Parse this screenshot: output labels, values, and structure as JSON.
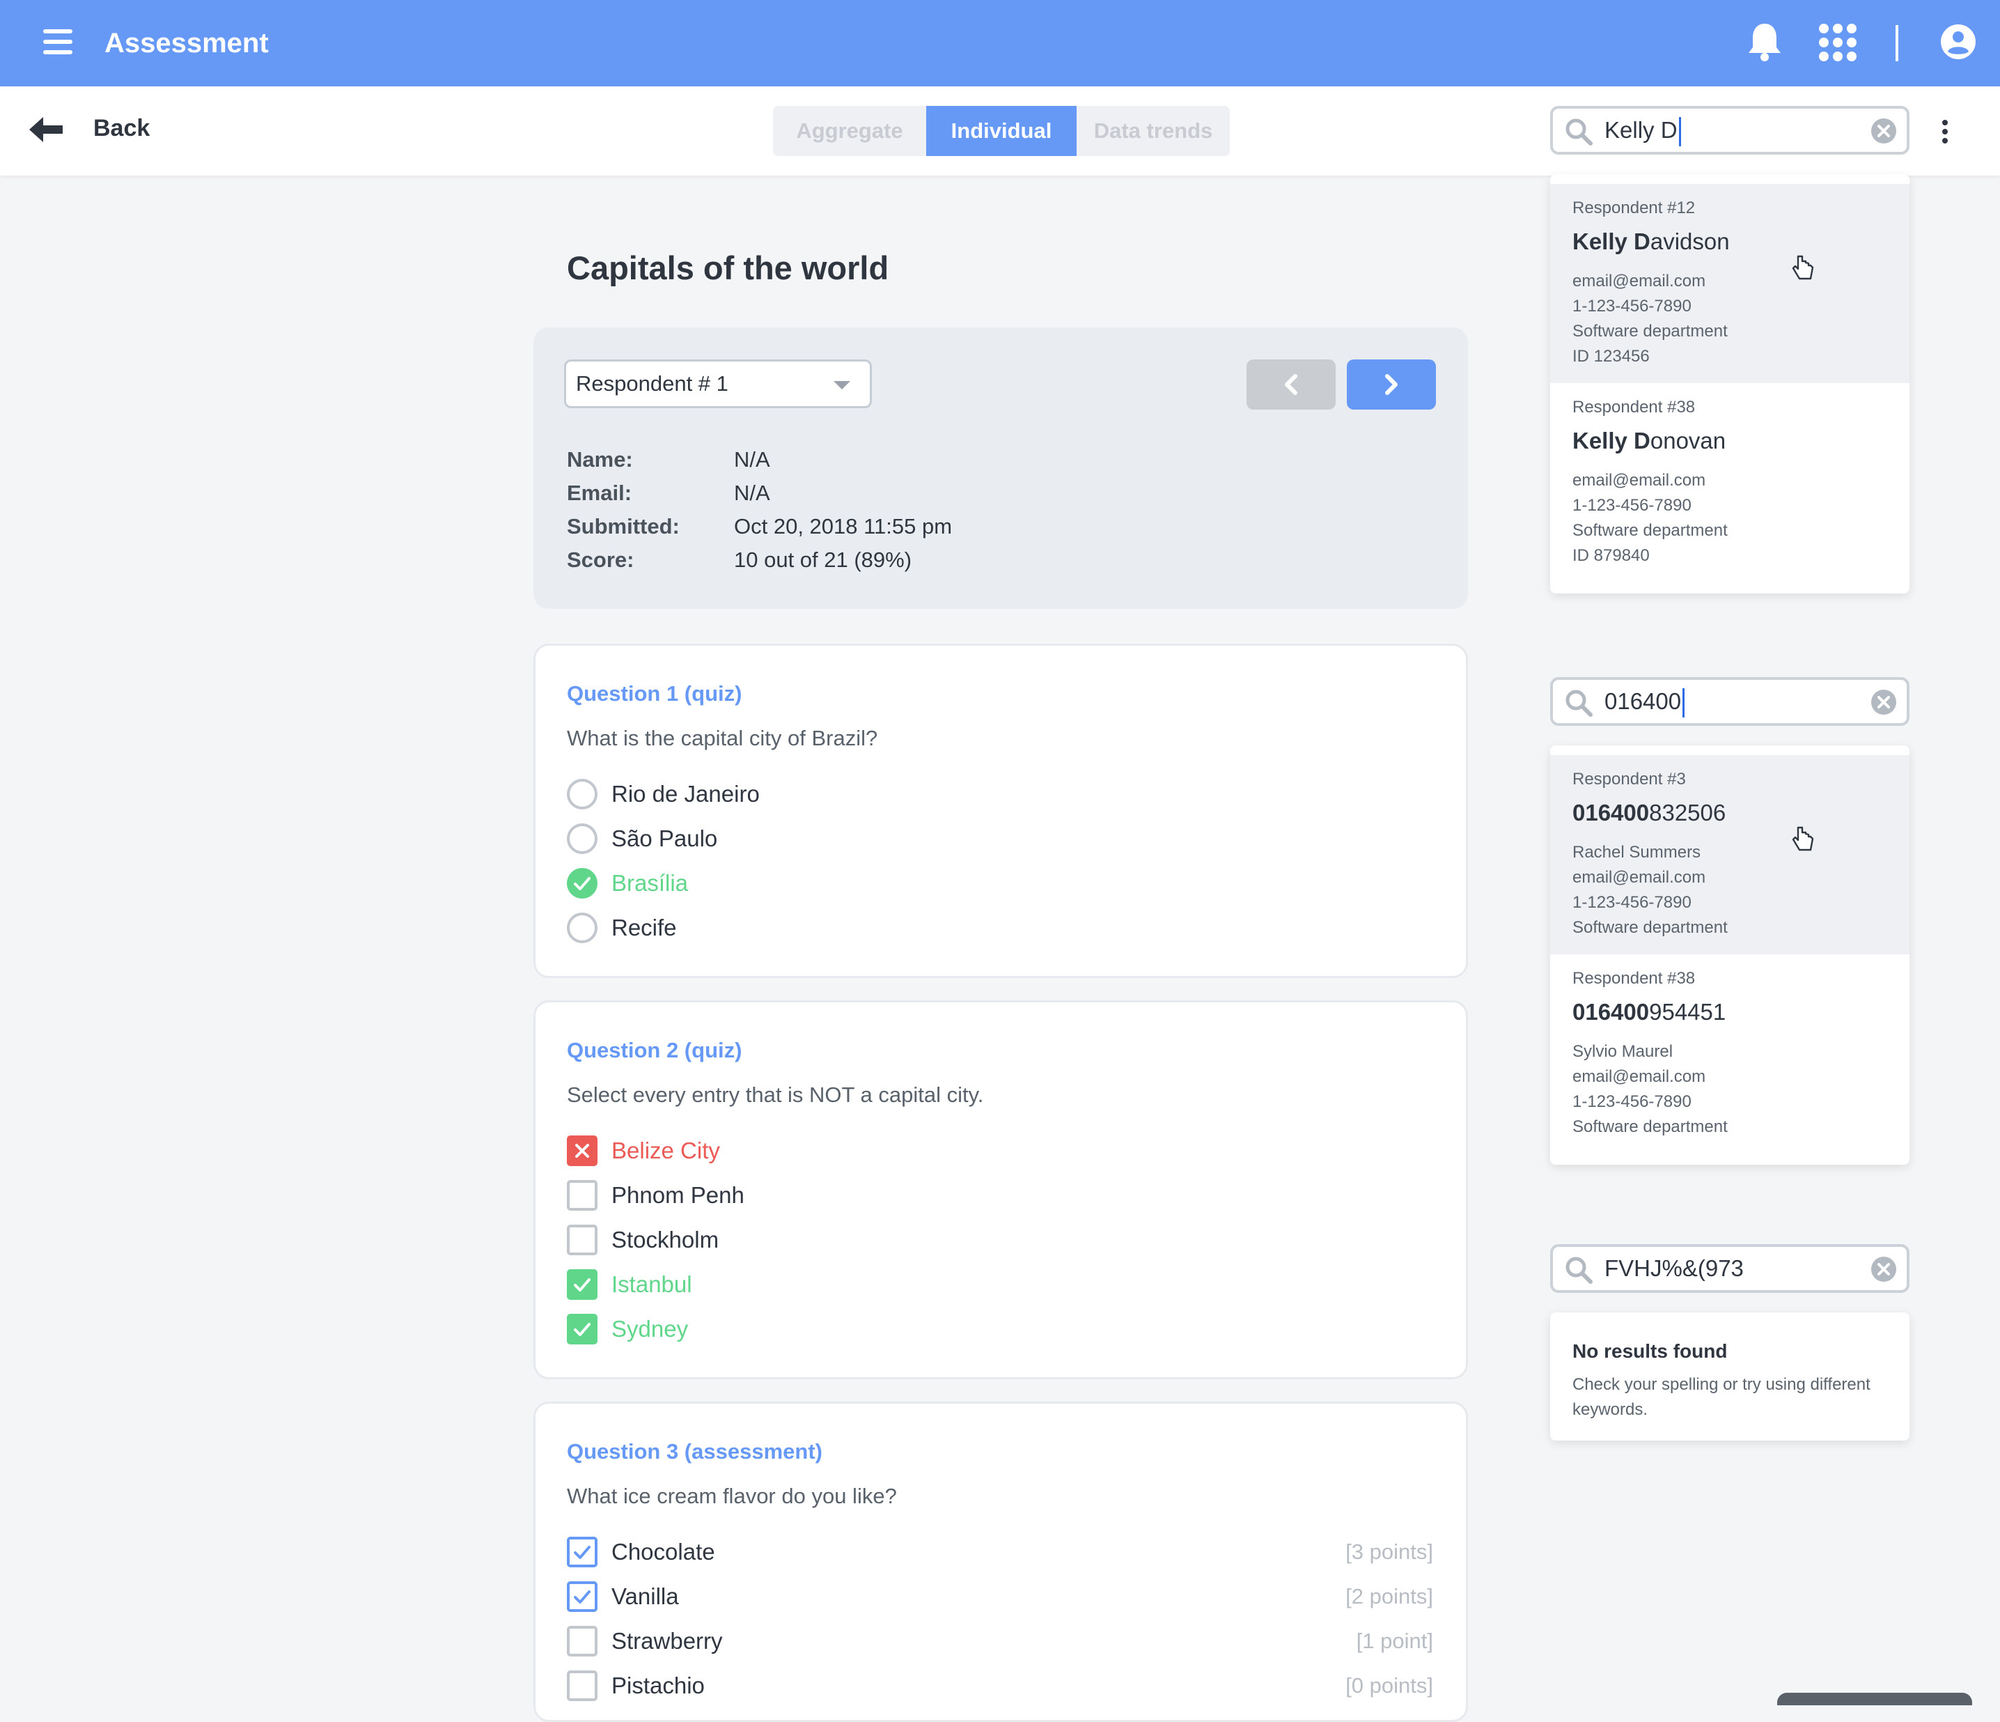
{
  "app": {
    "title": "Assessment"
  },
  "subheader": {
    "back_label": "Back",
    "tabs": [
      {
        "label": "Aggregate",
        "active": false
      },
      {
        "label": "Individual",
        "active": true
      },
      {
        "label": "Data trends",
        "active": false
      }
    ]
  },
  "survey": {
    "title": "Capitals of the world",
    "respondent_select": "Respondent # 1",
    "info": [
      {
        "label": "Name:",
        "value": "N/A"
      },
      {
        "label": "Email:",
        "value": "N/A"
      },
      {
        "label": "Submitted:",
        "value": "Oct 20, 2018 11:55 pm"
      },
      {
        "label": "Score:",
        "value": "10 out of 21 (89%)"
      }
    ]
  },
  "questions": [
    {
      "title": "Question 1 (quiz)",
      "text": "What is the capital city of Brazil?",
      "options": [
        {
          "label": "Rio de Janeiro",
          "state": "none"
        },
        {
          "label": "São Paulo",
          "state": "none"
        },
        {
          "label": "Brasília",
          "state": "correct"
        },
        {
          "label": "Recife",
          "state": "none"
        }
      ]
    },
    {
      "title": "Question 2 (quiz)",
      "text": "Select every entry that is NOT a capital city.",
      "options": [
        {
          "label": "Belize City",
          "state": "wrong"
        },
        {
          "label": "Phnom Penh",
          "state": "none"
        },
        {
          "label": "Stockholm",
          "state": "none"
        },
        {
          "label": "Istanbul",
          "state": "correct"
        },
        {
          "label": "Sydney",
          "state": "correct"
        }
      ]
    },
    {
      "title": "Question 3 (assessment)",
      "text": "What ice cream flavor do you like?",
      "options": [
        {
          "label": "Chocolate",
          "state": "selected",
          "points": "[3 points]"
        },
        {
          "label": "Vanilla",
          "state": "selected",
          "points": "[2 points]"
        },
        {
          "label": "Strawberry",
          "state": "none",
          "points": "[1 point]"
        },
        {
          "label": "Pistachio",
          "state": "none",
          "points": "[0 points]"
        }
      ]
    }
  ],
  "search_examples": [
    {
      "query": "Kelly D",
      "results": [
        {
          "respondent": "Respondent #12",
          "match": "Kelly D",
          "rest": "avidson",
          "details": [
            "email@email.com",
            "1-123-456-7890",
            "Software department",
            "ID 123456"
          ]
        },
        {
          "respondent": "Respondent #38",
          "match": "Kelly D",
          "rest": "onovan",
          "details": [
            "email@email.com",
            "1-123-456-7890",
            "Software department",
            "ID 879840"
          ]
        }
      ]
    },
    {
      "query": "016400",
      "results": [
        {
          "respondent": "Respondent #3",
          "match": "016400",
          "rest": "832506",
          "details": [
            "Rachel Summers",
            "email@email.com",
            "1-123-456-7890",
            "Software department"
          ]
        },
        {
          "respondent": "Respondent #38",
          "match": "016400",
          "rest": "954451",
          "details": [
            "Sylvio Maurel",
            "email@email.com",
            "1-123-456-7890",
            "Software department"
          ]
        }
      ]
    },
    {
      "query": "FVHJ%&(973",
      "no_results_title": "No results found",
      "no_results_text": "Check your spelling or try using different keywords."
    }
  ],
  "colors": {
    "primary": "#6699f5",
    "correct": "#5fd68a",
    "wrong": "#ec5a55"
  }
}
